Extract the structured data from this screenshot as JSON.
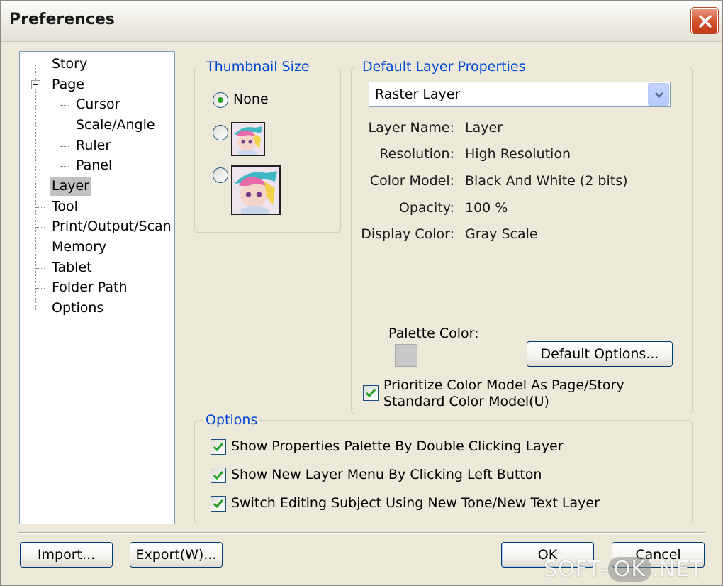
{
  "window": {
    "title": "Preferences"
  },
  "tree": {
    "items": [
      {
        "label": "Story"
      },
      {
        "label": "Page"
      },
      {
        "label": "Cursor"
      },
      {
        "label": "Scale/Angle"
      },
      {
        "label": "Ruler"
      },
      {
        "label": "Panel"
      },
      {
        "label": "Layer",
        "selected": true
      },
      {
        "label": "Tool"
      },
      {
        "label": "Print/Output/Scan"
      },
      {
        "label": "Memory"
      },
      {
        "label": "Tablet"
      },
      {
        "label": "Folder Path"
      },
      {
        "label": "Options"
      }
    ]
  },
  "thumbnail_size": {
    "legend": "Thumbnail Size",
    "options": [
      {
        "label": "None",
        "checked": true
      },
      {
        "label": "",
        "checked": false
      },
      {
        "label": "",
        "checked": false
      }
    ]
  },
  "default_layer": {
    "legend": "Default Layer Properties",
    "layer_type": "Raster Layer",
    "properties": [
      {
        "label": "Layer Name:",
        "value": "Layer"
      },
      {
        "label": "Resolution:",
        "value": "High Resolution"
      },
      {
        "label": "Color Model:",
        "value": "Black And White (2 bits)"
      },
      {
        "label": "Opacity:",
        "value": "100 %"
      },
      {
        "label": "Display Color:",
        "value": "Gray Scale"
      }
    ],
    "palette_label": "Palette Color:",
    "palette_color": "#c8c8c8",
    "default_options_label": "Default Options...",
    "prioritize_line1": "Prioritize Color Model As Page/Story",
    "prioritize_line2": "Standard Color Model(U)",
    "prioritize_checked": true
  },
  "options": {
    "legend": "Options",
    "checkboxes": [
      {
        "label": "Show Properties Palette By Double Clicking Layer",
        "checked": true
      },
      {
        "label": "Show New Layer Menu By Clicking Left Button",
        "checked": true
      },
      {
        "label": "Switch Editing Subject Using New Tone/New Text Layer",
        "checked": true
      }
    ]
  },
  "footer": {
    "import_label": "Import...",
    "export_label": "Export(W)...",
    "ok_label": "OK",
    "cancel_label": "Cancel"
  },
  "watermark": {
    "left": "SOFT-",
    "mid": "OK",
    "right": ".NET"
  },
  "colors": {
    "accent": "#0046d5",
    "selection": "#c0c0c0",
    "check": "#21a121"
  }
}
